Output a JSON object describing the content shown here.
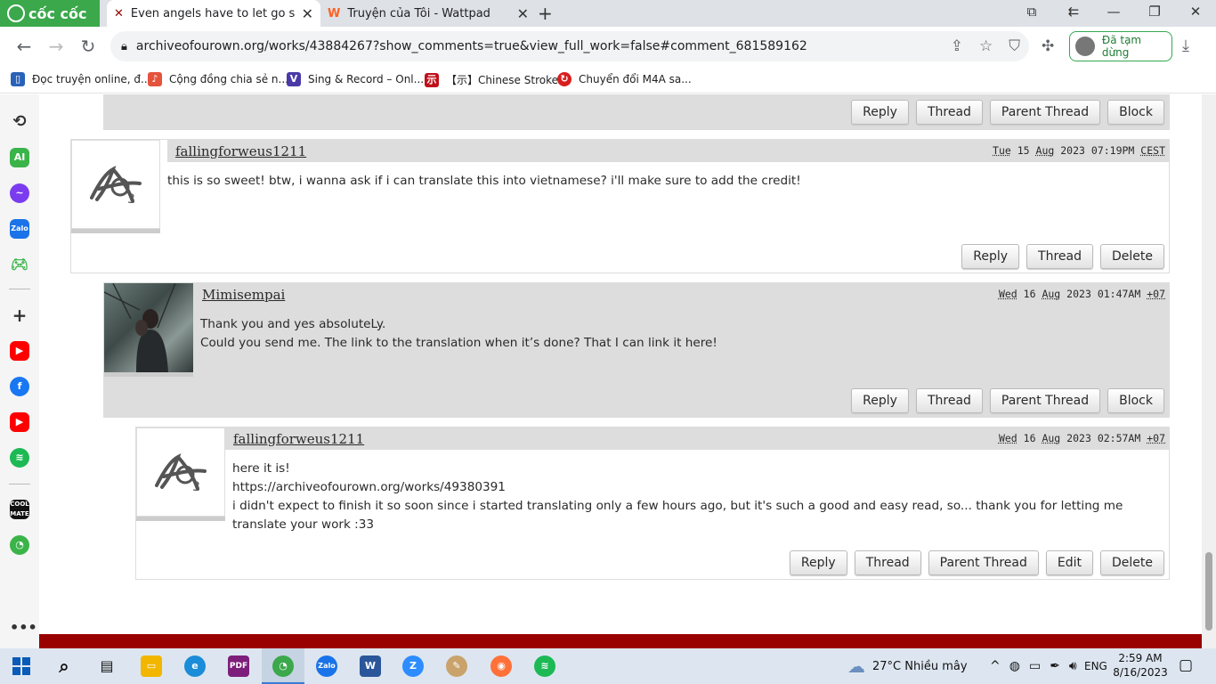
{
  "browser": {
    "brand": "cốc cốc",
    "tabs": [
      {
        "title": "Even angels have to let go someti",
        "active": true,
        "icon": "ao3-icon"
      },
      {
        "title": "Truyện của Tôi - Wattpad",
        "active": false,
        "icon": "wattpad-icon"
      }
    ],
    "url": "archiveofourown.org/works/43884267?show_comments=true&view_full_work=false#comment_681589162",
    "profile_label": "Đã tạm dừng",
    "bookmarks": [
      {
        "label": "Đọc truyện online, đ...",
        "icon": "book-icon",
        "color": "#2a62b8"
      },
      {
        "label": "Cộng đồng chia sẻ n...",
        "icon": "soundwave-icon",
        "color": "#e5533d"
      },
      {
        "label": "Sing & Record – Onl...",
        "icon": "v-icon",
        "color": "#4a3aa8"
      },
      {
        "label": "【示】Chinese Stroke...",
        "icon": "chinese-char-icon",
        "color": "#c0101a"
      },
      {
        "label": "Chuyển đổi M4A sa...",
        "icon": "convert-icon",
        "color": "#d81e1e"
      }
    ]
  },
  "top_actions": [
    "Reply",
    "Thread",
    "Parent Thread",
    "Block"
  ],
  "comments": [
    {
      "user": "fallingforweus1211",
      "date": [
        "Tue",
        "15",
        "Aug",
        "2023",
        "07:19PM",
        "CEST"
      ],
      "lines": [
        "this is so sweet! btw, i wanna ask if i can translate this into vietnamese? i'll make sure to add the credit!"
      ],
      "actions": [
        "Reply",
        "Thread",
        "Delete"
      ]
    },
    {
      "user": "Mimisempai",
      "date": [
        "Wed",
        "16",
        "Aug",
        "2023",
        "01:47AM",
        "+07"
      ],
      "lines": [
        "Thank you and yes absoluteLy.",
        "Could you send me. The link to the translation when it’s done? That I can link it here!"
      ],
      "actions": [
        "Reply",
        "Thread",
        "Parent Thread",
        "Block"
      ]
    },
    {
      "user": "fallingforweus1211",
      "date": [
        "Wed",
        "16",
        "Aug",
        "2023",
        "02:57AM",
        "+07"
      ],
      "lines": [
        "here it is!",
        "https://archiveofourown.org/works/49380391",
        "i didn't expect to finish it so soon since i started translating only a few hours ago, but it's such a good and easy read, so... thank you for letting me",
        "translate your work :33"
      ],
      "actions": [
        "Reply",
        "Thread",
        "Parent Thread",
        "Edit",
        "Delete"
      ]
    }
  ],
  "taskbar": {
    "weather": "27°C  Nhiều mây",
    "lang": "ENG",
    "time": "2:59 AM",
    "date": "8/16/2023"
  },
  "colors": {
    "ao3_red": "#990000",
    "coccoc_green": "#3aa84b",
    "active_profile": "#34a853"
  }
}
